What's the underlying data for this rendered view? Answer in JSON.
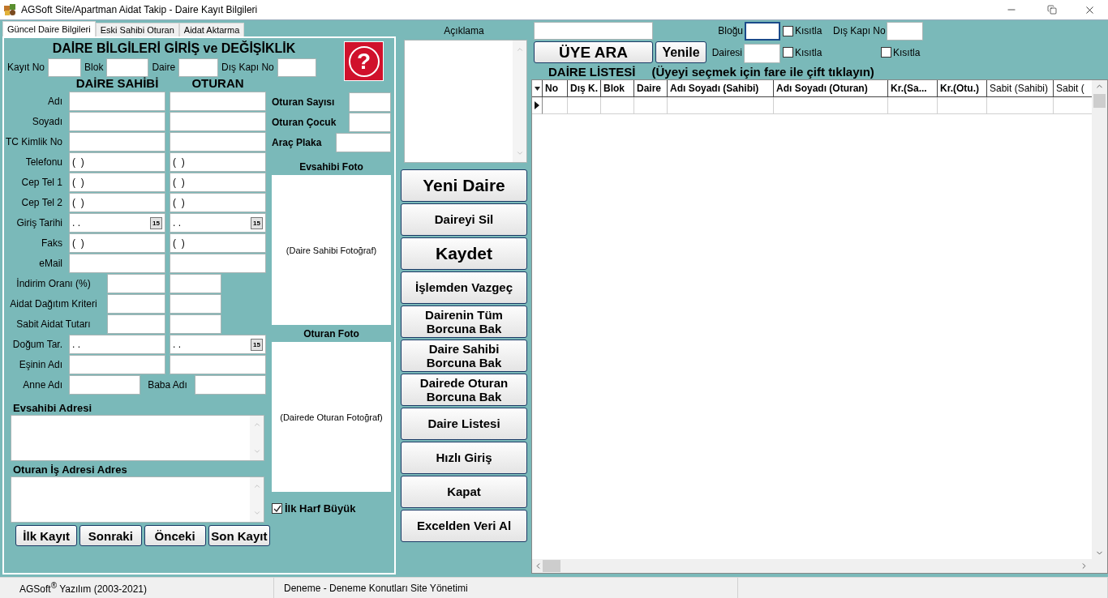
{
  "window": {
    "title": "AGSoft Site/Apartman Aidat Takip - Daire Kayıt Bilgileri"
  },
  "tabs": [
    {
      "label": "Güncel Daire Bilgileri",
      "selected": true
    },
    {
      "label": "Eski Sahibi Oturan",
      "selected": false
    },
    {
      "label": "Aidat Aktarma",
      "selected": false
    }
  ],
  "form": {
    "heading": "DAİRE BİLGİLERİ GİRİŞ ve DEĞİŞİKLİK",
    "help": "?",
    "id_fields": [
      "Kayıt No",
      "Blok",
      "Daire",
      "Dış Kapı No"
    ],
    "column_headers": [
      "DAİRE SAHİBİ",
      "OTURAN"
    ],
    "rows": [
      {
        "kind": "wide",
        "label": "Adı"
      },
      {
        "kind": "wide",
        "label": "Soyadı"
      },
      {
        "kind": "wide",
        "label": "TC Kimlik No"
      },
      {
        "kind": "wide",
        "label": "Telefonu",
        "values": [
          "(  )",
          "(  )"
        ]
      },
      {
        "kind": "wide",
        "label": "Cep Tel 1",
        "values": [
          "(  )",
          "(  )"
        ]
      },
      {
        "kind": "wide",
        "label": "Cep Tel 2",
        "values": [
          "(  )",
          "(  )"
        ]
      },
      {
        "kind": "wide",
        "label": "Giriş Tarihi",
        "fields": [
          {
            "value": ". .",
            "calendar": "15"
          },
          {
            "value": ". .",
            "calendar": "15"
          }
        ]
      },
      {
        "kind": "wide",
        "label": "Faks",
        "values": [
          "(  )",
          "(  )"
        ]
      },
      {
        "kind": "wide",
        "label": "eMail"
      },
      {
        "kind": "narrow",
        "label": "İndirim Oranı (%)"
      },
      {
        "kind": "narrow",
        "label": "Aidat Dağıtım Kriteri"
      },
      {
        "kind": "narrow",
        "label": "Sabit Aidat Tutarı"
      },
      {
        "kind": "wide",
        "label": "Doğum Tar.",
        "fields": [
          {
            "value": ". ."
          },
          {
            "value": ". .",
            "calendar": "15"
          }
        ]
      },
      {
        "kind": "wide",
        "label": "Eşinin Adı"
      },
      {
        "kind": "split",
        "label": "Anne Adı",
        "second_label": "Baba Adı"
      }
    ],
    "side_fields": [
      {
        "kind": "short",
        "label": "Oturan Sayısı"
      },
      {
        "kind": "short",
        "label": "Oturan Çocuk"
      },
      {
        "kind": "long",
        "label": "Araç Plaka"
      }
    ],
    "photos": [
      {
        "title": "Evsahibi Foto",
        "caption": "(Daire Sahibi Fotoğraf)"
      },
      {
        "title": "Oturan Foto",
        "caption": "(Dairede Oturan Fotoğraf)"
      }
    ],
    "capitalize": {
      "label": "İlk Harf Büyük",
      "checked": true
    },
    "addresses": [
      "Evsahibi Adresi",
      "Oturan İş Adresi Adres"
    ],
    "nav_buttons": [
      "İlk Kayıt",
      "Sonraki",
      "Önceki",
      "Son Kayıt"
    ]
  },
  "description": {
    "label": "Açıklama"
  },
  "actions": [
    {
      "label": "Yeni Daire",
      "kind": "large"
    },
    {
      "label": "Daireyi Sil",
      "kind": "normal"
    },
    {
      "label": "Kaydet",
      "kind": "large"
    },
    {
      "label": "İşlemden Vazgeç",
      "kind": "normal"
    },
    {
      "label": "Dairenin Tüm Borcuna Bak",
      "kind": "normal"
    },
    {
      "label": "Daire Sahibi Borcuna Bak",
      "kind": "normal"
    },
    {
      "label": "Dairede Oturan Borcuna Bak",
      "kind": "normal"
    },
    {
      "label": "Daire Listesi",
      "kind": "normal"
    },
    {
      "label": "Hızlı Giriş",
      "kind": "normal"
    },
    {
      "label": "Kapat",
      "kind": "normal"
    },
    {
      "label": "Excelden Veri Al",
      "kind": "normal"
    }
  ],
  "search": {
    "button": "ÜYE ARA",
    "refresh": "Yenile",
    "block": {
      "label": "Bloğu",
      "focused": true
    },
    "block_restrict": {
      "label": "Kısıtla",
      "checked": false
    },
    "door": {
      "label": "Dış Kapı No"
    },
    "flat": {
      "label": "Dairesi",
      "focused": false
    },
    "flat_restrict": {
      "label": "Kısıtla",
      "checked": false
    },
    "door_restrict": {
      "label": "Kısıtla",
      "checked": false
    }
  },
  "list": {
    "title": "DAİRE LİSTESİ",
    "hint": "(Üyeyi seçmek için fare ile çift tıklayın)",
    "columns": [
      {
        "label": "No",
        "bold": true
      },
      {
        "label": "Dış K.",
        "bold": true
      },
      {
        "label": "Blok",
        "bold": true
      },
      {
        "label": "Daire",
        "bold": true
      },
      {
        "label": "Adı Soyadı (Sahibi)",
        "bold": true
      },
      {
        "label": "Adı Soyadı (Oturan)",
        "bold": true
      },
      {
        "label": "Kr.(Sa...",
        "bold": true
      },
      {
        "label": "Kr.(Otu.)",
        "bold": true
      },
      {
        "label": "Sabit (Sahibi)",
        "bold": false
      },
      {
        "label": "Sabit (",
        "bold": false
      }
    ],
    "rows": [
      {
        "current": true
      }
    ]
  },
  "status_bar": [
    "AGSoft$^{®}$ Yazılım (2003-2021)",
    "Deneme - Deneme Konutları Site Yönetimi"
  ]
}
